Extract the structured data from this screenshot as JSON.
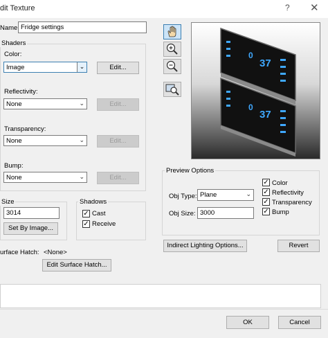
{
  "window": {
    "title": "dit Texture",
    "help": "?",
    "close": "✕"
  },
  "name": {
    "label": "Name:",
    "value": "Fridge settings"
  },
  "shaders": {
    "title": "Shaders",
    "color": {
      "label": "Color:",
      "value": "Image",
      "edit": "Edit..."
    },
    "reflectivity": {
      "label": "Reflectivity:",
      "value": "None",
      "edit": "Edit..."
    },
    "transparency": {
      "label": "Transparency:",
      "value": "None",
      "edit": "Edit..."
    },
    "bump": {
      "label": "Bump:",
      "value": "None",
      "edit": "Edit..."
    }
  },
  "size": {
    "title": "Size",
    "value": "3014",
    "button": "Set By Image..."
  },
  "shadows": {
    "title": "Shadows",
    "cast": "Cast",
    "receive": "Receive"
  },
  "surface_hatch": {
    "label": "urface Hatch:",
    "value": "<None>",
    "button": "Edit Surface Hatch..."
  },
  "preview_options": {
    "title": "Preview Options",
    "obj_type_label": "Obj Type:",
    "obj_type": "Plane",
    "obj_size_label": "Obj Size:",
    "obj_size": "3000",
    "checks": [
      "Color",
      "Reflectivity",
      "Transparency",
      "Bump"
    ]
  },
  "preview_display": {
    "top_temp": "37",
    "top_small": "0",
    "bottom_temp": "37",
    "bottom_small": "0"
  },
  "buttons": {
    "indirect_lighting": "Indirect Lighting Options...",
    "revert": "Revert",
    "ok": "OK",
    "cancel": "Cancel"
  },
  "tools": [
    "hand-tool-icon",
    "zoom-in-icon",
    "zoom-out-icon",
    "zoom-region-icon"
  ]
}
